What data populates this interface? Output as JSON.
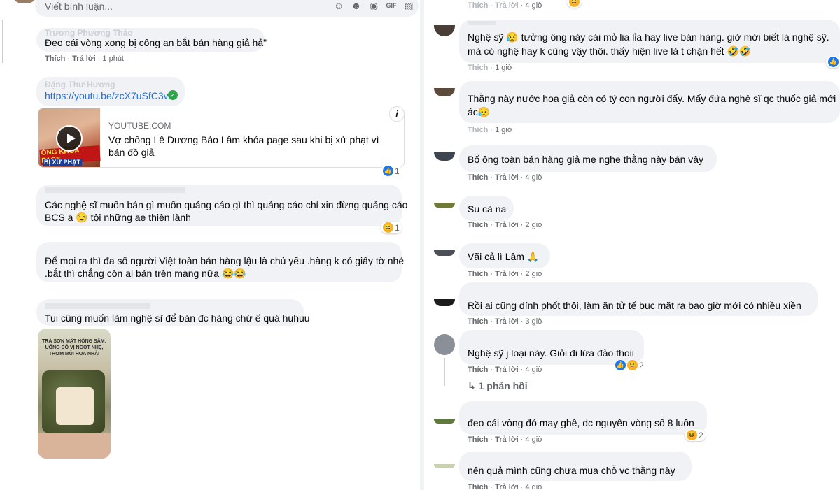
{
  "composer": {
    "placeholder": "Viết bình luận...",
    "icons": [
      "sticker-icon",
      "emoji-icon",
      "camera-icon",
      "gif-icon",
      "sticker-alt-icon"
    ]
  },
  "meta": {
    "like": "Thích",
    "reply": "Trả lời",
    "sep": " · "
  },
  "left_comments": [
    {
      "author": "Trương Phương Thảo",
      "text": [
        "Đeo cái vòng xong bị công an bắt bán hàng giả hả\""
      ],
      "time": "1 phút"
    },
    {
      "author": "Đặng Thư Hương",
      "link": "https://youtu.be/zcX7uSfC3vI"
    },
    {
      "text": [
        "Các nghệ sĩ muốn bán gì muốn quảng cáo gì thì quảng cáo chỉ xin đừng quảng cáo",
        "BCS ạ 😉 tội những ae thiện lành"
      ],
      "reaction_count": "1"
    },
    {
      "text": [
        "Để mọi ra thì đa số người Việt toàn bán hàng lậu là chủ yếu .hàng k có giấy tờ nhé",
        ".bắt thì chẳng còn ai bán trên mạng nữa 😂😂"
      ]
    },
    {
      "text": [
        "Tui cũng muốn làm nghệ sĩ để bán đc hàng chứ ế quá huhuu"
      ]
    }
  ],
  "link_preview": {
    "domain": "YOUTUBE.COM",
    "title": "Vợ chồng Lê Dương Bảo Lâm khóa page sau khi bị xử phạt vì bán đồ giả",
    "thumb_caption_1": "ÓNG KHÓA PAGE",
    "thumb_caption_2": "BỊ XỬ PHẠT",
    "reaction_count": "1"
  },
  "photo": {
    "caption": "TRÀ SƠN MẬT HỒNG SÂM: UỐNG CÓ VỊ NGỌT NHẸ, THƠM MÙI HOA NHÀI"
  },
  "right_comments": [
    {
      "text": [
        "Nghệ sỹ 😥 tưởng ông này cái mỏ lia lỉa hay live bán hàng. giờ mới biết là nghệ sỹ.",
        "mà có nghệ hay k cũng vậy thôi. thấy hiện live là t chặn hết 🤣🤣"
      ],
      "time": "1 giờ"
    },
    {
      "text": [
        "Thằng này nước hoa giả còn có tý con người đấy. Mấy đứa nghệ sĩ qc thuốc giả mới",
        "ác😥"
      ],
      "time": "1 giờ"
    },
    {
      "text": [
        "Bố ông toàn bán hàng giả mẹ nghe thằng này bán vậy"
      ],
      "time": "4 giờ"
    },
    {
      "text": [
        "Su cà na"
      ],
      "time": "2 giờ"
    },
    {
      "text": [
        "Vãi cả lì Lâm 🙏"
      ],
      "time": "2 giờ"
    },
    {
      "text": [
        "Rồi ai cũng dính phốt thôi, làm ăn tử tế bục mặt ra bao giờ mới có nhiều xiền"
      ],
      "time": "3 giờ"
    },
    {
      "text": [
        "Nghệ sỹ j loại này. Giỏi đi lừa đảo thoii"
      ],
      "time": "4 giờ",
      "reaction_count": "2",
      "replies": "1 phản hồi"
    },
    {
      "text": [
        "đeo cái vòng đó may ghê, dc nguyên vòng số 8 luôn"
      ],
      "time": "4 giờ",
      "reaction_count": "2"
    },
    {
      "text": [
        "nên quả mình cũng chưa mua chỗ vc thằng này"
      ],
      "time": "4 giờ"
    }
  ],
  "top_right": {
    "time": "4 giờ"
  },
  "colors": {
    "bubble": "#f0f2f5",
    "link": "#216fdb",
    "like_blue": "#1877f2",
    "meta": "#65676b"
  }
}
